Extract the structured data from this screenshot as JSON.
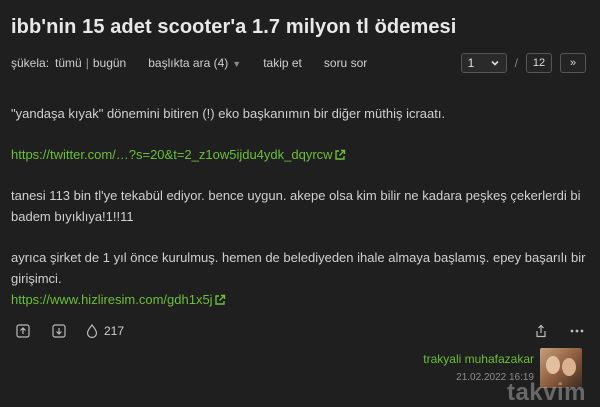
{
  "topic": {
    "title": "ibb'nin 15 adet scooter'a 1.7 milyon tl ödemesi"
  },
  "subnav": {
    "sukela_label": "şükela:",
    "all_label": "tümü",
    "separator": "|",
    "today_label": "bugün",
    "search_label": "başlıkta ara (4)",
    "follow_label": "takip et",
    "ask_label": "soru sor"
  },
  "pager": {
    "current": "1",
    "slash": "/",
    "total": "12",
    "next": "»"
  },
  "entry": {
    "p1": "\"yandaşa kıyak\" dönemini bitiren (!) eko başkanımın bir diğer müthiş icraatı.",
    "link1": "https://twitter.com/…?s=20&t=2_z1ow5ijdu4ydk_dqyrcw",
    "p2": "tanesi 113 bin tl'ye tekabül ediyor. bence uygun. akepe olsa kim bilir ne kadara peşkeş çekerlerdi bi badem bıyıklıya!1!!11",
    "p3": "ayrıca şirket de 1 yıl önce kurulmuş. hemen de belediyeden ihale almaya başlamış. epey başarılı bir girişimci.",
    "link2": "https://www.hizliresim.com/gdh1x5j"
  },
  "actions": {
    "fav_count": "217"
  },
  "author": {
    "name": "trakyali muhafazakar",
    "date": "21.02.2022 16:19"
  },
  "watermark": {
    "text": "takvim"
  },
  "colors": {
    "link": "#6bbf3a",
    "background": "#1f1f1f"
  },
  "icons": [
    "upvote-icon",
    "downvote-icon",
    "drop-icon",
    "share-icon",
    "more-icon",
    "external-link-icon",
    "chevron-down-icon"
  ]
}
